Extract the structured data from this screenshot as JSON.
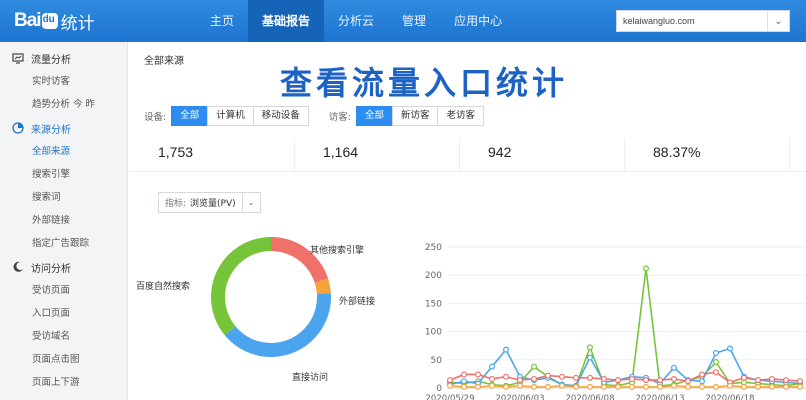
{
  "brand": {
    "logo_text_a": "Bai",
    "logo_text_b": "统计"
  },
  "nav": {
    "items": [
      {
        "label": "主页"
      },
      {
        "label": "基础报告"
      },
      {
        "label": "分析云"
      },
      {
        "label": "管理"
      },
      {
        "label": "应用中心"
      }
    ],
    "active_index": 1
  },
  "site_select": {
    "value": "kelaiwangluo.com"
  },
  "sidebar": {
    "groups": [
      {
        "label": "流量分析",
        "icon": "monitor-icon",
        "items": [
          "实时访客",
          "趋势分析 今 昨"
        ]
      },
      {
        "label": "来源分析",
        "icon": "pie-icon",
        "active": true,
        "items": [
          "全部来源",
          "搜索引擎",
          "搜索词",
          "外部链接",
          "指定广告跟踪"
        ]
      },
      {
        "label": "访问分析",
        "icon": "moon-icon",
        "items": [
          "受访页面",
          "入口页面",
          "受访域名",
          "页面点击图",
          "页面上下游"
        ]
      }
    ],
    "active_item": "全部来源"
  },
  "page": {
    "crumb": "全部来源",
    "overlay_title": "查看流量入口统计",
    "device_label": "设备:",
    "device_options": [
      "全部",
      "计算机",
      "移动设备"
    ],
    "visitor_label": "访客:",
    "visitor_options": [
      "全部",
      "新访客",
      "老访客"
    ],
    "stats": [
      "1,753",
      "1,164",
      "942",
      "88.37%"
    ],
    "metric_label": "指标:",
    "metric_value": "浏览量(PV)"
  },
  "colors": {
    "accent": "#2d8cf0",
    "nav": "#1e74d0",
    "green": "#76c43a",
    "red": "#f0706a",
    "orange": "#f7a33c",
    "blue": "#4ba5ee"
  },
  "chart_data": [
    {
      "type": "pie",
      "slices": [
        {
          "label": "其他搜索引擎",
          "value": 20,
          "color": "#f0706a"
        },
        {
          "label": "外部链接",
          "value": 4,
          "color": "#f7a33c"
        },
        {
          "label": "直接访问",
          "value": 40,
          "color": "#4ba5ee"
        },
        {
          "label": "百度自然搜索",
          "value": 36,
          "color": "#76c43a"
        }
      ]
    },
    {
      "type": "line",
      "ylim": [
        0,
        250
      ],
      "yticks": [
        0,
        50,
        100,
        150,
        200,
        250
      ],
      "xticks": [
        "2020/05/29",
        "2020/06/03",
        "2020/06/08",
        "2020/06/13",
        "2020/06/18"
      ],
      "points": 26,
      "series": [
        {
          "color": "#76c43a",
          "values": [
            10,
            8,
            12,
            6,
            4,
            10,
            38,
            20,
            6,
            4,
            72,
            6,
            4,
            10,
            212,
            4,
            6,
            14,
            20,
            46,
            8,
            10,
            8,
            6,
            4,
            8
          ]
        },
        {
          "color": "#4ba5ee",
          "values": [
            6,
            12,
            8,
            38,
            68,
            20,
            14,
            18,
            6,
            4,
            54,
            10,
            14,
            20,
            18,
            8,
            36,
            14,
            12,
            62,
            70,
            20,
            14,
            12,
            10,
            8
          ]
        },
        {
          "color": "#f0706a",
          "values": [
            14,
            24,
            24,
            16,
            20,
            14,
            16,
            22,
            20,
            18,
            18,
            16,
            14,
            16,
            14,
            14,
            16,
            12,
            24,
            28,
            10,
            18,
            14,
            16,
            14,
            12
          ]
        },
        {
          "color": "#f7a33c",
          "values": [
            4,
            2,
            2,
            4,
            2,
            4,
            2,
            2,
            4,
            2,
            2,
            2,
            2,
            2,
            2,
            2,
            4,
            2,
            2,
            2,
            4,
            2,
            2,
            2,
            2,
            2
          ]
        }
      ]
    }
  ]
}
